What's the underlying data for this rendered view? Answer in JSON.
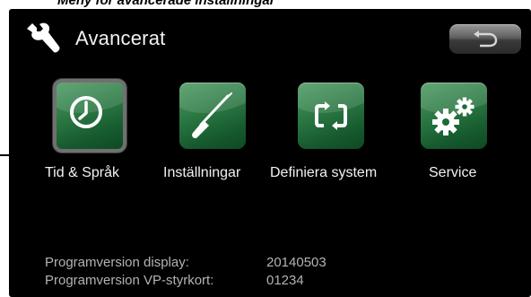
{
  "document": {
    "heading": "Meny för avancerade inställningar"
  },
  "header": {
    "title": "Avancerat",
    "back_icon": "back-arrow-icon",
    "title_icon": "wrench-icon"
  },
  "menu": {
    "items": [
      {
        "label": "Tid & Språk",
        "icon": "clock-icon",
        "selected": true
      },
      {
        "label": "Inställningar",
        "icon": "screwdriver-icon",
        "selected": false
      },
      {
        "label": "Definiera system",
        "icon": "cycle-arrows-icon",
        "selected": false
      },
      {
        "label": "Service",
        "icon": "gears-icon",
        "selected": false
      }
    ]
  },
  "info": {
    "display_label": "Programversion display:",
    "display_value": "20140503",
    "controller_label": "Programversion VP-styrkort:",
    "controller_value": "01234"
  },
  "colors": {
    "background": "#000000",
    "tile_green": "#2d7a45",
    "text": "#f2f2f2",
    "info_text": "#b3b3b3"
  }
}
